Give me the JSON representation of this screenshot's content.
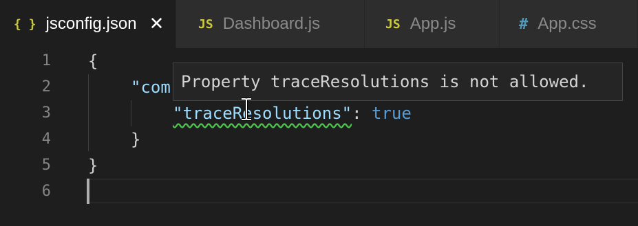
{
  "tabs": [
    {
      "label": "jsconfig.json",
      "icon_text": "{ }",
      "icon": "json-braces-icon",
      "active": true,
      "close": "✕"
    },
    {
      "label": "Dashboard.js",
      "icon_text": "JS",
      "icon": "js-icon",
      "active": false
    },
    {
      "label": "App.js",
      "icon_text": "JS",
      "icon": "js-icon",
      "active": false
    },
    {
      "label": "App.css",
      "icon_text": "#",
      "icon": "css-hash-icon",
      "active": false
    }
  ],
  "editor": {
    "line_numbers": [
      "1",
      "2",
      "3",
      "4",
      "5",
      "6"
    ],
    "line1": "{",
    "line2_key": "\"com",
    "line3_key": "\"traceResolutions\"",
    "line3_colon": ": ",
    "line3_value": "true",
    "line4": "}",
    "line5": "}"
  },
  "hover": {
    "message": "Property traceResolutions is not allowed."
  },
  "colors": {
    "background": "#1e1e1e",
    "tab_inactive": "#2d2d2d",
    "json_key": "#9cdcfe",
    "boolean": "#569cd6",
    "squiggle": "#4ec24e"
  }
}
